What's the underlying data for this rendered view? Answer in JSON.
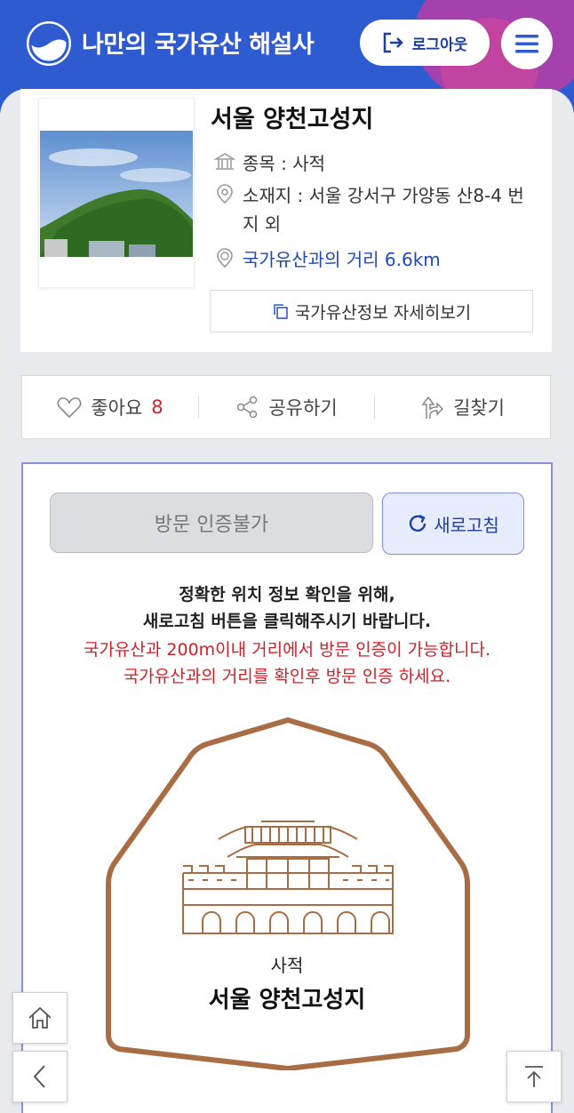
{
  "header": {
    "brand": "나만의 국가유산 해설사",
    "logout_label": "로그아웃"
  },
  "site": {
    "title": "서울 양천고성지",
    "type_label": "종목 : 사적",
    "address_label": "소재지 : 서울 강서구 가양동 산8-4 번지 외",
    "distance_label": "국가유산과의 거리 6.6km",
    "detail_button": "국가유산정보 자세히보기"
  },
  "actions": {
    "like_label": "좋아요",
    "like_count": "8",
    "share_label": "공유하기",
    "directions_label": "길찾기"
  },
  "certification": {
    "status_button": "방문 인증불가",
    "refresh_button": "새로고침",
    "instruction_line1": "정확한 위치 정보 확인을 위해,",
    "instruction_line2": "새로고침 버튼을 클릭해주시기 바랍니다.",
    "warning_line1": "국가유산과 200m이내 거리에서 방문 인증이 가능합니다.",
    "warning_line2": "국가유산과의 거리를 확인후 방문 인증 하세요.",
    "badge_type": "사적",
    "badge_name": "서울 양천고성지"
  },
  "colors": {
    "header_blue": "#2f5bd0",
    "accent_blue": "#2248b8",
    "warning_red": "#d0202a",
    "badge_brown": "#a86d45"
  },
  "icons": {
    "logo": "korea-heritage-logo",
    "logout": "logout-icon",
    "menu": "hamburger-menu-icon",
    "type": "museum-icon",
    "address": "location-pin-icon",
    "distance": "distance-pin-icon",
    "detail": "copy-icon",
    "like": "heart-icon",
    "share": "share-icon",
    "directions": "directions-icon",
    "refresh": "refresh-icon",
    "home": "home-icon",
    "back": "chevron-left-icon",
    "top": "scroll-top-icon"
  }
}
